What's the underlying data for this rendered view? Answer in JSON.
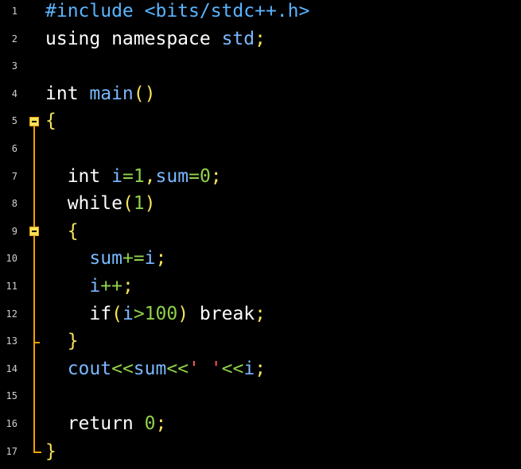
{
  "editor": {
    "line_numbers": [
      "1",
      "2",
      "3",
      "4",
      "5",
      "6",
      "7",
      "8",
      "9",
      "10",
      "11",
      "12",
      "13",
      "14",
      "15",
      "16",
      "17"
    ],
    "lines": [
      [
        {
          "t": "#include <bits/stdc++.h>",
          "c": "pp"
        }
      ],
      [
        {
          "t": "using namespace ",
          "c": "plain"
        },
        {
          "t": "std",
          "c": "var"
        },
        {
          "t": ";",
          "c": "punc"
        }
      ],
      [],
      [
        {
          "t": "int ",
          "c": "plain"
        },
        {
          "t": "main",
          "c": "var"
        },
        {
          "t": "()",
          "c": "punc"
        }
      ],
      [
        {
          "t": "{",
          "c": "punc"
        }
      ],
      [],
      [
        {
          "t": "  int ",
          "c": "plain"
        },
        {
          "t": "i",
          "c": "var"
        },
        {
          "t": "=",
          "c": "op"
        },
        {
          "t": "1",
          "c": "num"
        },
        {
          "t": ",",
          "c": "punc"
        },
        {
          "t": "sum",
          "c": "var"
        },
        {
          "t": "=",
          "c": "op"
        },
        {
          "t": "0",
          "c": "num"
        },
        {
          "t": ";",
          "c": "punc"
        }
      ],
      [
        {
          "t": "  while",
          "c": "plain"
        },
        {
          "t": "(",
          "c": "punc"
        },
        {
          "t": "1",
          "c": "num"
        },
        {
          "t": ")",
          "c": "punc"
        }
      ],
      [
        {
          "t": "  {",
          "c": "punc"
        }
      ],
      [
        {
          "t": "    sum",
          "c": "var"
        },
        {
          "t": "+=",
          "c": "op"
        },
        {
          "t": "i",
          "c": "var"
        },
        {
          "t": ";",
          "c": "punc"
        }
      ],
      [
        {
          "t": "    i",
          "c": "var"
        },
        {
          "t": "++",
          "c": "op"
        },
        {
          "t": ";",
          "c": "punc"
        }
      ],
      [
        {
          "t": "    if",
          "c": "plain"
        },
        {
          "t": "(",
          "c": "punc"
        },
        {
          "t": "i",
          "c": "var"
        },
        {
          "t": ">",
          "c": "op"
        },
        {
          "t": "100",
          "c": "num"
        },
        {
          "t": ") ",
          "c": "punc"
        },
        {
          "t": "break",
          "c": "plain"
        },
        {
          "t": ";",
          "c": "punc"
        }
      ],
      [
        {
          "t": "  }",
          "c": "punc"
        }
      ],
      [
        {
          "t": "  cout",
          "c": "var"
        },
        {
          "t": "<<",
          "c": "op"
        },
        {
          "t": "sum",
          "c": "var"
        },
        {
          "t": "<<",
          "c": "op"
        },
        {
          "t": "'",
          "c": "str"
        },
        {
          "t": " ",
          "c": "plain"
        },
        {
          "t": "'",
          "c": "str"
        },
        {
          "t": "<<",
          "c": "op"
        },
        {
          "t": "i",
          "c": "var"
        },
        {
          "t": ";",
          "c": "punc"
        }
      ],
      [],
      [
        {
          "t": "  return ",
          "c": "plain"
        },
        {
          "t": "0",
          "c": "num"
        },
        {
          "t": ";",
          "c": "punc"
        }
      ],
      [
        {
          "t": "}",
          "c": "punc"
        }
      ]
    ]
  },
  "colors": {
    "background": "#000000",
    "preprocessor": "#5ab4ff",
    "number": "#8fd14a",
    "punctuation": "#f5e35a",
    "identifier": "#7ab8ff",
    "string": "#ff5a5a",
    "fold_marker": "#f0a000"
  }
}
